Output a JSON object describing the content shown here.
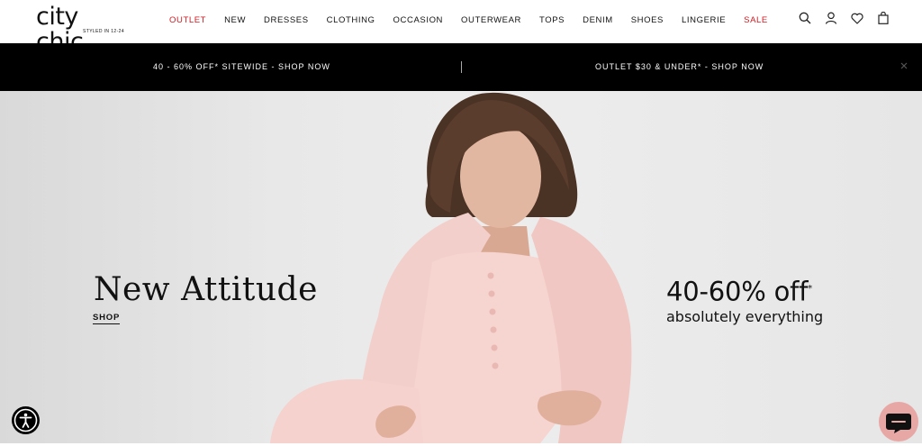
{
  "brand": {
    "logo_text": "city chic",
    "tagline": "STYLED IN 12-24"
  },
  "nav": {
    "items": [
      {
        "label": "OUTLET",
        "highlight": true
      },
      {
        "label": "NEW",
        "highlight": false
      },
      {
        "label": "DRESSES",
        "highlight": false
      },
      {
        "label": "CLOTHING",
        "highlight": false
      },
      {
        "label": "OCCASION",
        "highlight": false
      },
      {
        "label": "OUTERWEAR",
        "highlight": false
      },
      {
        "label": "TOPS",
        "highlight": false
      },
      {
        "label": "DENIM",
        "highlight": false
      },
      {
        "label": "SHOES",
        "highlight": false
      },
      {
        "label": "LINGERIE",
        "highlight": false
      },
      {
        "label": "SALE",
        "highlight": true
      }
    ],
    "icons": [
      "search-icon",
      "account-icon",
      "wishlist-heart-icon",
      "shopping-bag-icon"
    ],
    "highlight_color": "#d0191f"
  },
  "promo_bar": {
    "left": "40 - 60% OFF* SITEWIDE - SHOP NOW",
    "right": "OUTLET $30 & UNDER* - SHOP NOW",
    "close_icon": "close-icon",
    "background": "#000000"
  },
  "hero": {
    "headline": "New Attitude",
    "cta": "SHOP",
    "offer_main": "40-60% off",
    "offer_asterisk": "*",
    "offer_sub": "absolutely everything"
  },
  "widgets": {
    "accessibility_icon": "accessibility-icon",
    "chat_icon": "chat-icon",
    "chat_color": "#e7a7a5"
  }
}
